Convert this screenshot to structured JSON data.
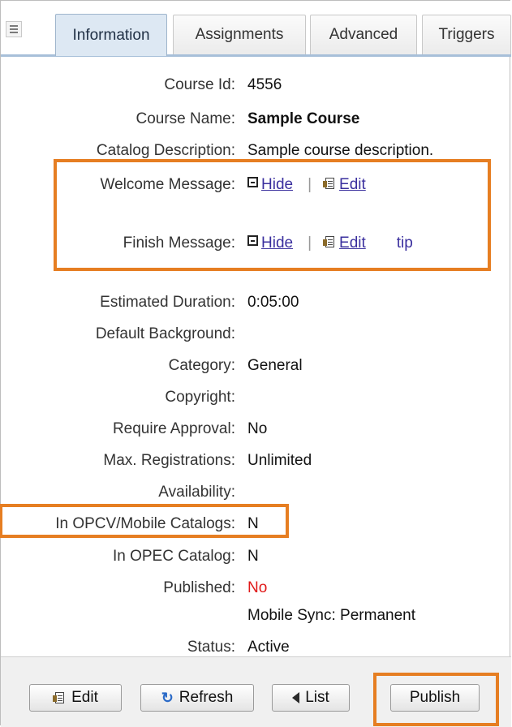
{
  "tabs": [
    {
      "label": "Information",
      "active": true
    },
    {
      "label": "Assignments"
    },
    {
      "label": "Advanced"
    },
    {
      "label": "Triggers"
    }
  ],
  "fields": {
    "course_id": {
      "label": "Course Id:",
      "value": "4556"
    },
    "course_name": {
      "label": "Course Name:",
      "value": "Sample Course"
    },
    "catalog_description": {
      "label": "Catalog Description:",
      "value": "Sample course description."
    },
    "welcome_message": {
      "label": "Welcome Message:",
      "hide": "Hide",
      "separator": "|",
      "edit": "Edit"
    },
    "finish_message": {
      "label": "Finish Message:",
      "hide": "Hide",
      "separator": "|",
      "edit": "Edit",
      "tip": "tip"
    },
    "estimated_duration": {
      "label": "Estimated Duration:",
      "value": "0:05:00"
    },
    "default_background": {
      "label": "Default Background:",
      "value": ""
    },
    "category": {
      "label": "Category:",
      "value": "General"
    },
    "copyright": {
      "label": "Copyright:",
      "value": ""
    },
    "require_approval": {
      "label": "Require Approval:",
      "value": "No"
    },
    "max_registrations": {
      "label": "Max. Registrations:",
      "value": "Unlimited"
    },
    "availability": {
      "label": "Availability:",
      "value": ""
    },
    "in_opcv_mobile": {
      "label": "In OPCV/Mobile Catalogs:",
      "value": "N"
    },
    "in_opec": {
      "label": "In OPEC Catalog:",
      "value": "N"
    },
    "published": {
      "label": "Published:",
      "value": "No",
      "value_color": "#e01818"
    },
    "mobile_sync": {
      "value": "Mobile Sync: Permanent"
    },
    "status": {
      "label": "Status:",
      "value": "Active"
    }
  },
  "toolbar": {
    "edit_label": "Edit",
    "refresh_label": "Refresh",
    "list_label": "List",
    "publish_label": "Publish"
  },
  "colors": {
    "highlight": "#e67e22",
    "link": "#3a2f9e",
    "active_tab": "#dde8f3"
  },
  "icons": {
    "menu": "menu-icon",
    "collapse": "collapse-icon",
    "edit": "edit-icon",
    "refresh": "refresh-icon",
    "back": "back-arrow-icon"
  }
}
